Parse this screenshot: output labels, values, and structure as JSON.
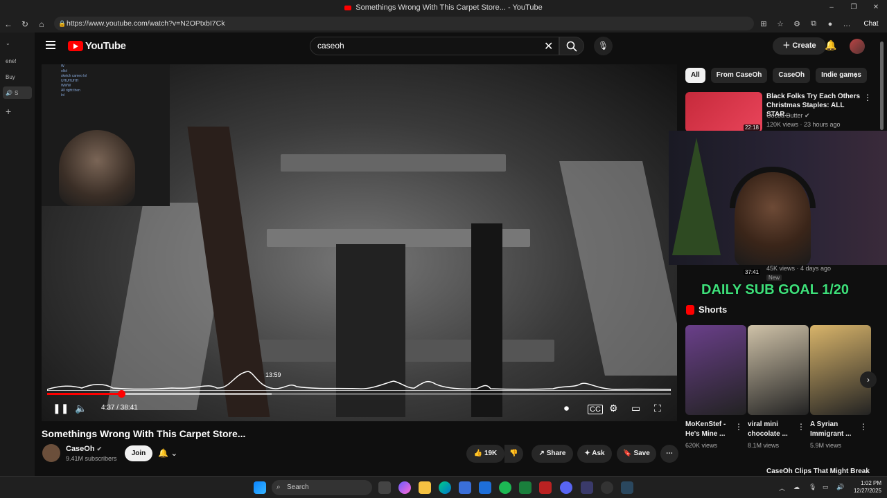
{
  "window": {
    "title": "Somethings Wrong With This Carpet Store... - YouTube",
    "controls": [
      "–",
      "❐",
      "✕"
    ]
  },
  "browser": {
    "url": "https://www.youtube.com/watch?v=N2OPtxbI7Ck",
    "chat_label": "Chat",
    "vertical_tabs": [
      "ene!",
      "Buy",
      "S"
    ]
  },
  "header": {
    "logo_text": "YouTube",
    "search_value": "caseoh",
    "create_label": "Create"
  },
  "player": {
    "hover_time": "13:59",
    "current_time": "4:37",
    "duration": "38:41",
    "timecode": "4:37 / 38:41",
    "progress_fraction": 0.119,
    "hover_fraction": 0.36,
    "webcam_chat": [
      "W",
      "ollol",
      "sketch cameo lol",
      "UHUHUHH",
      "WWW",
      "All right then",
      "lol"
    ]
  },
  "video_info": {
    "title": "Somethings Wrong With This Carpet Store...",
    "channel": "CaseOh",
    "subscribers": "9.41M subscribers",
    "join_label": "Join",
    "likes": "19K",
    "share_label": "Share",
    "ask_label": "Ask",
    "save_label": "Save"
  },
  "chips": [
    {
      "label": "All",
      "active": true
    },
    {
      "label": "From CaseOh",
      "active": false
    },
    {
      "label": "CaseOh",
      "active": false
    },
    {
      "label": "Indie games",
      "active": false
    }
  ],
  "recommendations": [
    {
      "title": "Black Folks Try Each Others Christmas Staples: ALL STAR...",
      "channel": "Cocoa Butter",
      "meta": "120K views · 23 hours ago",
      "duration": "22:18"
    },
    {
      "meta": "45K views · 4 days ago",
      "duration": "37:41",
      "badge": "New"
    }
  ],
  "overlay": {
    "sub_goal": "DAILY SUB GOAL 1/20"
  },
  "shorts": {
    "heading": "Shorts",
    "items": [
      {
        "title": "MoKenStef - He's Mine ...",
        "views": "620K views",
        "color": "#6a3f8a"
      },
      {
        "title": "viral mini chocolate ...",
        "views": "8.1M views",
        "color": "#cfc2a8"
      },
      {
        "title": "A Syrian Immigrant ...",
        "views": "5.9M views",
        "color": "#d8b46a"
      }
    ]
  },
  "bottom_rec_title": "CaseOh Clips That Might Break",
  "taskbar": {
    "search_label": "Search",
    "time": "1:02 PM",
    "date": "12/27/2025"
  }
}
